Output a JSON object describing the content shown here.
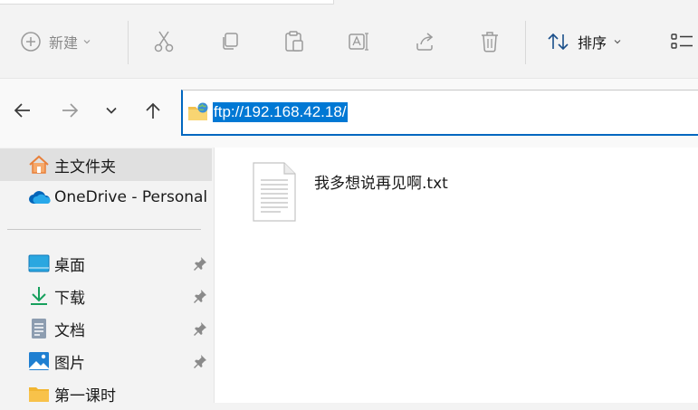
{
  "toolbar": {
    "new_label": "新建",
    "sort_label": "排序",
    "icons": [
      "plus-circle-icon",
      "scissors-icon",
      "copy-icon",
      "paste-icon",
      "rename-icon",
      "share-icon",
      "trash-icon",
      "sort-icon",
      "view-icon"
    ]
  },
  "address": {
    "path": "ftp://192.168.42.18/"
  },
  "sidebar": {
    "items": [
      {
        "label": "主文件夹",
        "icon": "home-icon",
        "selected": true
      },
      {
        "label": "OneDrive - Personal",
        "icon": "onedrive-icon"
      }
    ],
    "quick_access": [
      {
        "label": "桌面",
        "icon": "desktop-icon",
        "pinned": true
      },
      {
        "label": "下载",
        "icon": "download-icon",
        "pinned": true
      },
      {
        "label": "文档",
        "icon": "document-icon",
        "pinned": true
      },
      {
        "label": "图片",
        "icon": "picture-icon",
        "pinned": true
      },
      {
        "label": "第一课时",
        "icon": "folder-icon",
        "pinned": false
      }
    ]
  },
  "files": [
    {
      "name": "我多想说再见啊.txt",
      "icon": "text-file-icon"
    }
  ],
  "colors": {
    "accent": "#0078d4",
    "onedrive": "#0364b8",
    "home": "#e8803a",
    "folder": "#f8c24a"
  }
}
